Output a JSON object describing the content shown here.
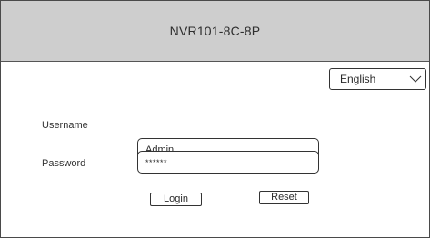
{
  "header": {
    "title": "NVR101-8C-8P"
  },
  "language": {
    "selected": "English"
  },
  "login_form": {
    "username_label": "Username",
    "username_value": "Admin",
    "password_label": "Password",
    "password_value": "******",
    "login_label": "Login",
    "reset_label": "Reset"
  }
}
